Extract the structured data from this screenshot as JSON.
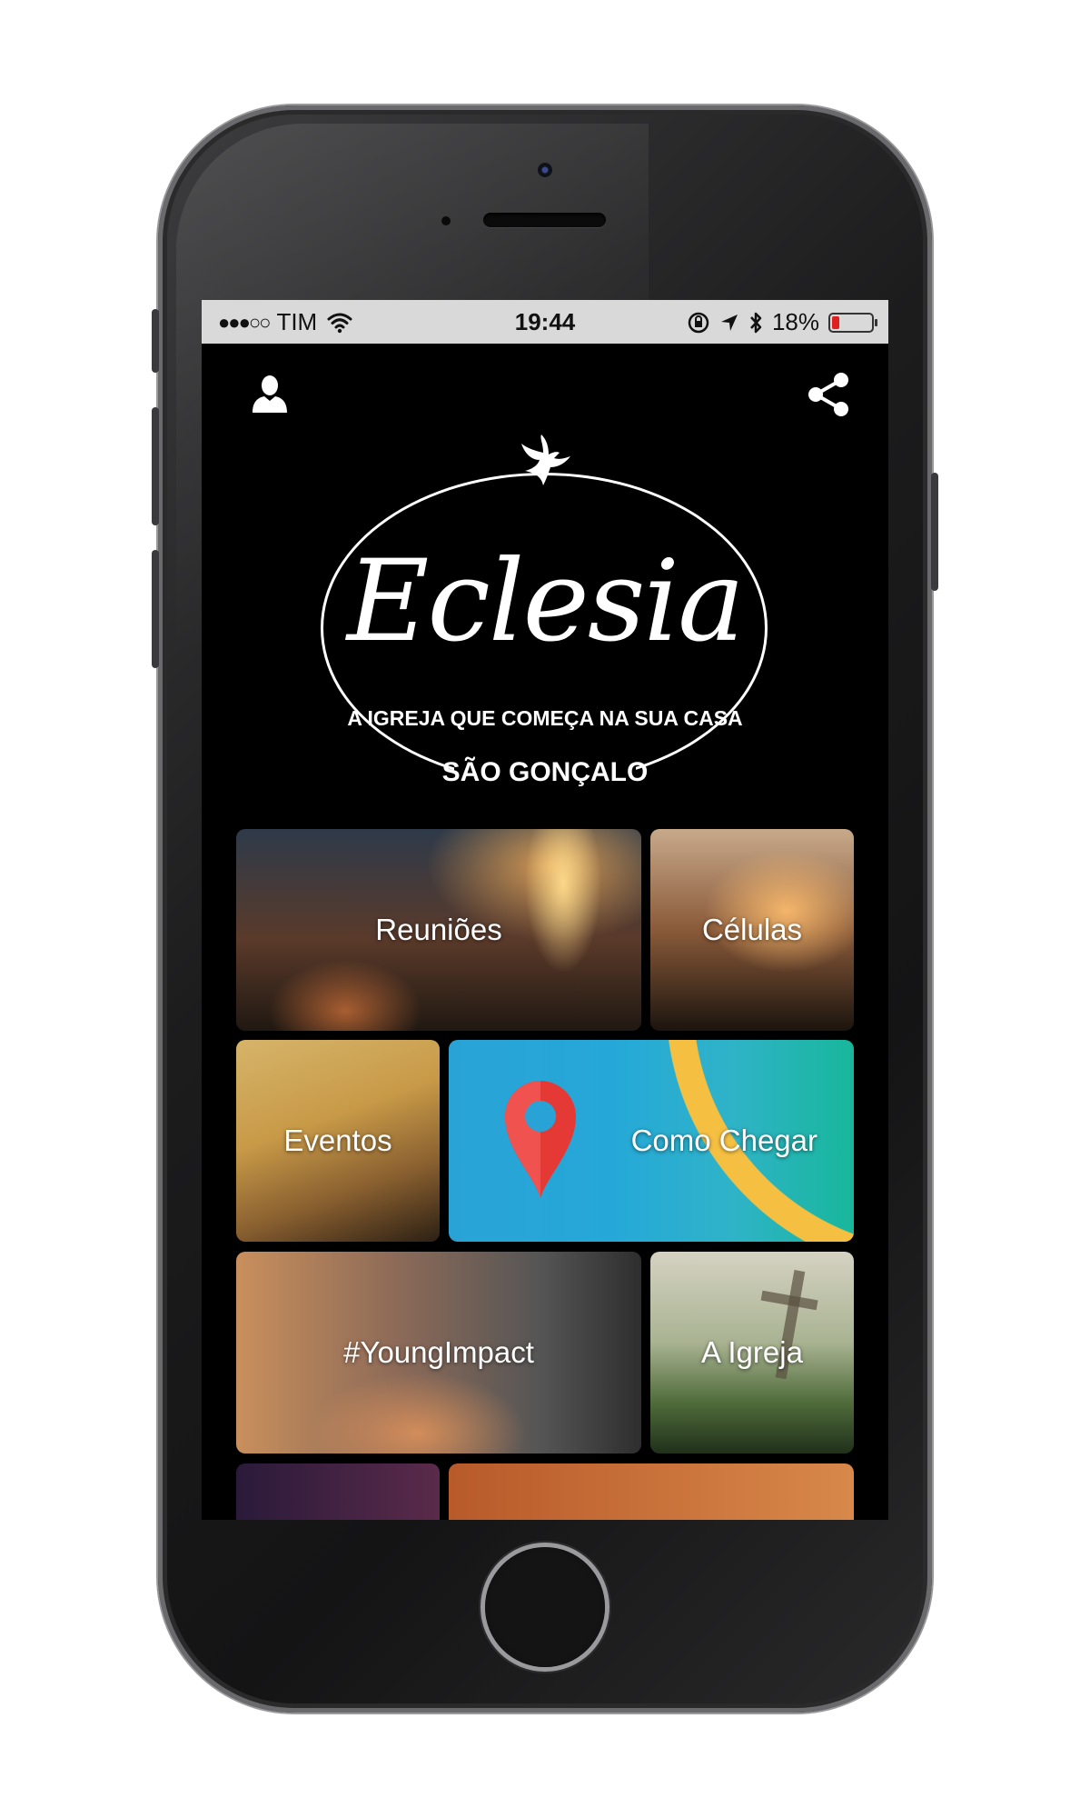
{
  "status_bar": {
    "carrier_dots": "●●●○○",
    "carrier": "TIM",
    "time": "19:44",
    "battery_percent": "18%",
    "battery_level": 0.18
  },
  "header": {
    "profile_icon": "user-icon",
    "share_icon": "share-icon"
  },
  "logo": {
    "name": "Eclesia",
    "tagline": "A IGREJA QUE COMEÇA NA SUA CASA",
    "city": "SÃO GONÇALO"
  },
  "tiles": [
    {
      "label": "Reuniões"
    },
    {
      "label": "Células"
    },
    {
      "label": "Eventos"
    },
    {
      "label": "Como Chegar"
    },
    {
      "label": "#YoungImpact"
    },
    {
      "label": "A Igreja"
    }
  ],
  "colors": {
    "screen_bg": "#000000",
    "status_bg": "#d9d9d9",
    "battery_low": "#e02020",
    "map_pin": "#e53935"
  }
}
